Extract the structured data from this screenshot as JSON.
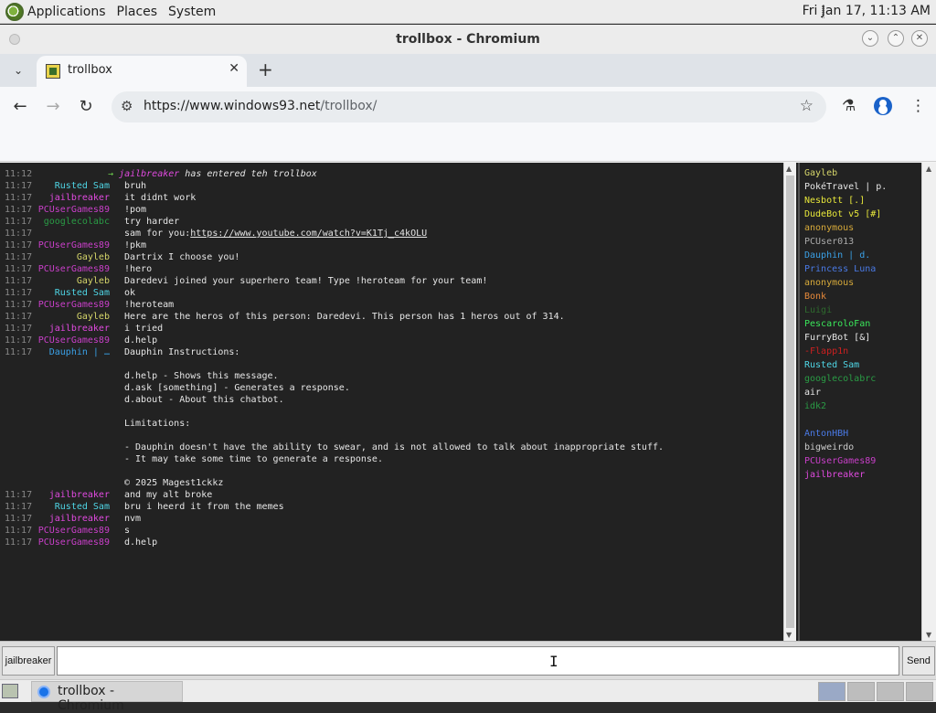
{
  "panel": {
    "menus": [
      "Applications",
      "Places",
      "System"
    ],
    "clock": "Fri Jan 17, 11:13 AM"
  },
  "window": {
    "title": "trollbox - Chromium"
  },
  "tabs": [
    {
      "label": "trollbox",
      "icon": "trollbox-favicon"
    }
  ],
  "toolbar": {
    "url_host": "https://www.windows93.net",
    "url_path": "/trollbox/"
  },
  "chat": {
    "messages": [
      {
        "time": "11:12",
        "nick": "",
        "nick_color": "",
        "text": "",
        "system": {
          "user": "jailbreaker",
          "text": " has entered teh trollbox"
        }
      },
      {
        "time": "11:17",
        "nick": "Rusted Sam",
        "nick_color": "#4fd6e6",
        "text": "bruh"
      },
      {
        "time": "11:17",
        "nick": "jailbreaker",
        "nick_color": "#e04adf",
        "text": "it didnt work"
      },
      {
        "time": "11:17",
        "nick": "PCUserGames89",
        "nick_color": "#c93fc9",
        "text": "!pom"
      },
      {
        "time": "11:17",
        "nick": "googlecolabc",
        "nick_color": "#2a9b45",
        "text": "try harder"
      },
      {
        "time": "11:17",
        "nick": "",
        "nick_color": "",
        "text": "sam for you:",
        "link": "https://www.youtube.com/watch?v=K1Tj_c4kOLU"
      },
      {
        "time": "11:17",
        "nick": "PCUserGames89",
        "nick_color": "#c93fc9",
        "text": "!pkm"
      },
      {
        "time": "11:17",
        "nick": "Gayleb",
        "nick_color": "#d6d66a",
        "text": "Dartrix I choose you!"
      },
      {
        "time": "11:17",
        "nick": "PCUserGames89",
        "nick_color": "#c93fc9",
        "text": "!hero"
      },
      {
        "time": "11:17",
        "nick": "Gayleb",
        "nick_color": "#d6d66a",
        "text": "Daredevi joined your superhero team! Type !heroteam for your team!"
      },
      {
        "time": "11:17",
        "nick": "Rusted Sam",
        "nick_color": "#4fd6e6",
        "text": "ok"
      },
      {
        "time": "11:17",
        "nick": "PCUserGames89",
        "nick_color": "#c93fc9",
        "text": "!heroteam"
      },
      {
        "time": "11:17",
        "nick": "Gayleb",
        "nick_color": "#d6d66a",
        "text": "Here are the heros of this person: Daredevi. This person has 1 heros out of 314."
      },
      {
        "time": "11:17",
        "nick": "jailbreaker",
        "nick_color": "#e04adf",
        "text": "i tried"
      },
      {
        "time": "11:17",
        "nick": "PCUserGames89",
        "nick_color": "#c93fc9",
        "text": "d.help"
      },
      {
        "time": "11:17",
        "nick": "Dauphin | …",
        "nick_color": "#3aa0e6",
        "text": "Dauphin Instructions:"
      },
      {
        "time": "",
        "nick": "",
        "nick_color": "",
        "text": ""
      },
      {
        "time": "",
        "nick": "",
        "nick_color": "",
        "text": "d.help - Shows this message."
      },
      {
        "time": "",
        "nick": "",
        "nick_color": "",
        "text": "d.ask [something] - Generates a response."
      },
      {
        "time": "",
        "nick": "",
        "nick_color": "",
        "text": "d.about - About this chatbot."
      },
      {
        "time": "",
        "nick": "",
        "nick_color": "",
        "text": ""
      },
      {
        "time": "",
        "nick": "",
        "nick_color": "",
        "text": "Limitations:"
      },
      {
        "time": "",
        "nick": "",
        "nick_color": "",
        "text": ""
      },
      {
        "time": "",
        "nick": "",
        "nick_color": "",
        "text": "- Dauphin doesn't have the ability to swear, and is not allowed to talk about inappropriate stuff."
      },
      {
        "time": "",
        "nick": "",
        "nick_color": "",
        "text": "- It may take some time to generate a response."
      },
      {
        "time": "",
        "nick": "",
        "nick_color": "",
        "text": ""
      },
      {
        "time": "",
        "nick": "",
        "nick_color": "",
        "text": "© 2025 Magest1ckkz"
      },
      {
        "time": "11:17",
        "nick": "jailbreaker",
        "nick_color": "#e04adf",
        "text": "and my alt broke"
      },
      {
        "time": "11:17",
        "nick": "Rusted Sam",
        "nick_color": "#4fd6e6",
        "text": "bru i heerd it from the memes"
      },
      {
        "time": "11:17",
        "nick": "jailbreaker",
        "nick_color": "#e04adf",
        "text": "nvm"
      },
      {
        "time": "11:17",
        "nick": "PCUserGames89",
        "nick_color": "#c93fc9",
        "text": "s"
      },
      {
        "time": "11:17",
        "nick": "PCUserGames89",
        "nick_color": "#c93fc9",
        "text": "d.help"
      }
    ]
  },
  "users": [
    {
      "name": "Gayleb",
      "color": "#d6d66a"
    },
    {
      "name": "PokéTravel | p.",
      "color": "#e6e6e6"
    },
    {
      "name": "Nesbott [.]",
      "color": "#e6e63a"
    },
    {
      "name": "DudeBot v5 [#]",
      "color": "#e6e63a"
    },
    {
      "name": "anonymous",
      "color": "#d6a93a"
    },
    {
      "name": "PCUser013",
      "color": "#aaaaaa"
    },
    {
      "name": "Dauphin | d.",
      "color": "#3aa0e6"
    },
    {
      "name": "Princess Luna",
      "color": "#4a7ae6"
    },
    {
      "name": "anonymous",
      "color": "#d6a93a"
    },
    {
      "name": "Bonk",
      "color": "#e6893a"
    },
    {
      "name": "Luigi",
      "color": "#2e6a2e"
    },
    {
      "name": "PescaroloFan",
      "color": "#3ae65a"
    },
    {
      "name": "FurryBot [&]",
      "color": "#e6e6e6"
    },
    {
      "name": "-Flapp1n",
      "color": "#cc2020"
    },
    {
      "name": "Rusted Sam",
      "color": "#4fd6e6"
    },
    {
      "name": "googlecolabrc",
      "color": "#2a9b45"
    },
    {
      "name": "air",
      "color": "#e6e6e6"
    },
    {
      "name": "idk2",
      "color": "#2a9b45"
    },
    {
      "name": "",
      "color": "#222"
    },
    {
      "name": "AntonHBH",
      "color": "#4a7ae6"
    },
    {
      "name": "bigweirdo",
      "color": "#cccccc"
    },
    {
      "name": "PCUserGames89",
      "color": "#c93fc9"
    },
    {
      "name": "jailbreaker",
      "color": "#e04adf"
    }
  ],
  "input": {
    "nick_button": "jailbreaker",
    "message_value": "",
    "send_label": "Send"
  },
  "taskbar": {
    "task_label": "trollbox - Chromium"
  }
}
